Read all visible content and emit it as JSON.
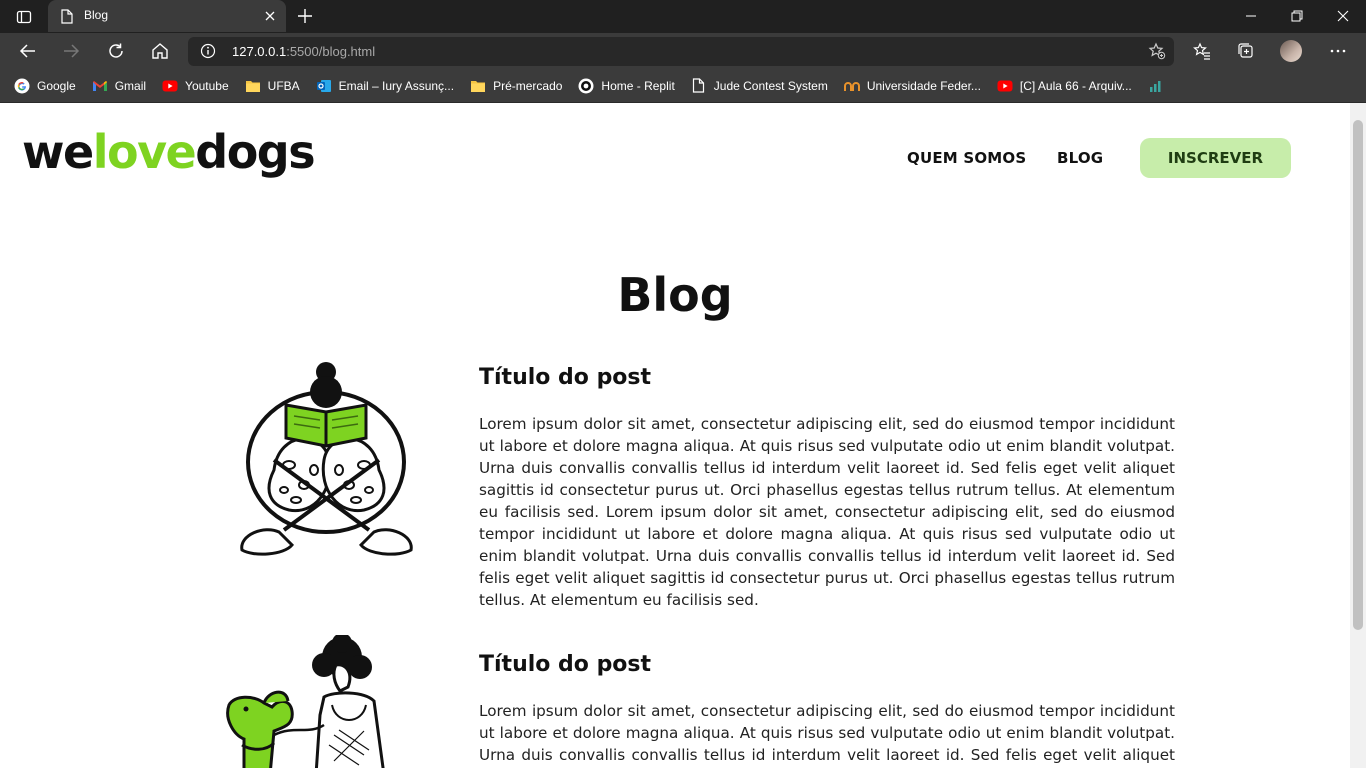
{
  "browser": {
    "tab_title": "Blog",
    "url_host": "127.0.0.1",
    "url_rest": ":5500/blog.html",
    "bookmarks": [
      {
        "label": "Google",
        "icon": "google-icon"
      },
      {
        "label": "Gmail",
        "icon": "gmail-icon"
      },
      {
        "label": "Youtube",
        "icon": "youtube-icon"
      },
      {
        "label": "UFBA",
        "icon": "folder-icon"
      },
      {
        "label": "Email – Iury Assunç...",
        "icon": "outlook-icon"
      },
      {
        "label": "Pré-mercado",
        "icon": "folder-icon"
      },
      {
        "label": "Home - Replit",
        "icon": "replit-icon"
      },
      {
        "label": "Jude Contest System",
        "icon": "page-icon"
      },
      {
        "label": "Universidade Feder...",
        "icon": "university-icon"
      },
      {
        "label": "[C] Aula 66 - Arquiv...",
        "icon": "youtube-icon"
      }
    ]
  },
  "site": {
    "logo_part1": "we",
    "logo_part2": "love",
    "logo_part3": "dogs",
    "nav": {
      "about": "QUEM SOMOS",
      "blog": "BLOG",
      "cta": "INSCREVER"
    },
    "accent_color": "#7ed321",
    "cta_bg": "#c7edaa"
  },
  "main": {
    "title": "Blog",
    "posts": [
      {
        "title": "Título do post",
        "body": "Lorem ipsum dolor sit amet, consectetur adipiscing elit, sed do eiusmod tempor incididunt ut labore et dolore magna aliqua. At quis risus sed vulputate odio ut enim blandit volutpat. Urna duis convallis convallis tellus id interdum velit laoreet id. Sed felis eget velit aliquet sagittis id consectetur purus ut. Orci phasellus egestas tellus rutrum tellus. At elementum eu facilisis sed. Lorem ipsum dolor sit amet, consectetur adipiscing elit, sed do eiusmod tempor incididunt ut labore et dolore magna aliqua. At quis risus sed vulputate odio ut enim blandit volutpat. Urna duis convallis convallis tellus id interdum velit laoreet id. Sed felis eget velit aliquet sagittis id consectetur purus ut. Orci phasellus egestas tellus rutrum tellus. At elementum eu facilisis sed.",
        "image": "person-reading-illustration"
      },
      {
        "title": "Título do post",
        "body": "Lorem ipsum dolor sit amet, consectetur adipiscing elit, sed do eiusmod tempor incididunt ut labore et dolore magna aliqua. At quis risus sed vulputate odio ut enim blandit volutpat. Urna duis convallis convallis tellus id interdum velit laoreet id. Sed felis eget velit aliquet sagittis id",
        "image": "person-with-dog-illustration"
      }
    ]
  }
}
